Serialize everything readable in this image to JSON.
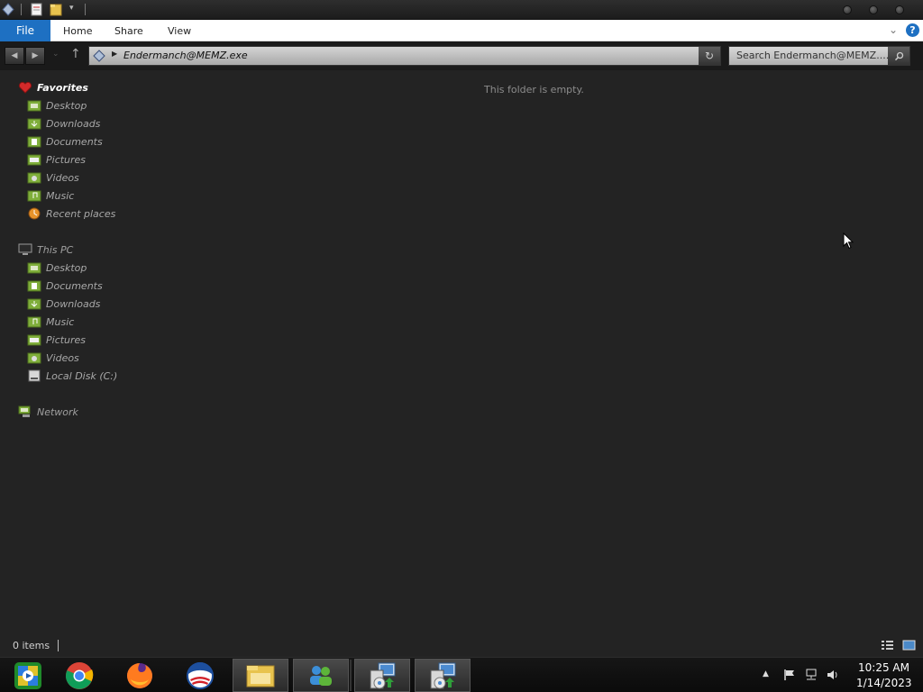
{
  "titlebar": {
    "quick_access": [
      "app-icon",
      "properties-icon",
      "new-folder-icon",
      "customize-dropdown-icon"
    ]
  },
  "ribbon": {
    "file_tab": "File",
    "tabs": [
      "Home",
      "Share",
      "View"
    ],
    "help": "?"
  },
  "address": {
    "path": "Endermanch@MEMZ.exe",
    "search_placeholder": "Search Endermanch@MEMZ...."
  },
  "navigation": {
    "favorites": {
      "label": "Favorites",
      "items": [
        "Desktop",
        "Downloads",
        "Documents",
        "Pictures",
        "Videos",
        "Music",
        "Recent places"
      ]
    },
    "this_pc": {
      "label": "This PC",
      "items": [
        "Desktop",
        "Documents",
        "Downloads",
        "Music",
        "Pictures",
        "Videos",
        "Local Disk (C:)"
      ]
    },
    "network": {
      "label": "Network"
    }
  },
  "content": {
    "empty_message": "This folder is empty."
  },
  "status": {
    "item_count": "0 items"
  },
  "taskbar": {
    "apps": [
      "windows-media-center-icon",
      "chrome-icon",
      "firefox-icon",
      "obama-logo-icon",
      "file-explorer-icon",
      "network-users-icon",
      "setup-installer-icon",
      "setup-installer-icon"
    ],
    "clock_time": "10:25 AM",
    "clock_date": "1/14/2023"
  },
  "colors": {
    "accent": "#1e70c2",
    "background": "#232323",
    "folder_green": "#7fae3a"
  }
}
